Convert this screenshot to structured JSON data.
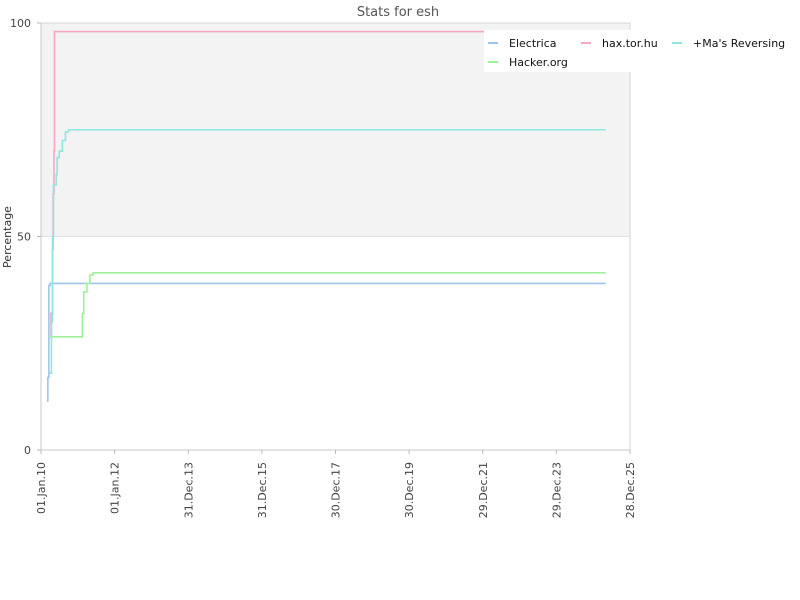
{
  "chart_data": {
    "type": "line",
    "title": "Stats for esh",
    "xlabel": "",
    "ylabel": "Percentage",
    "ylim": [
      0,
      100
    ],
    "xlim": [
      "2010-01-01",
      "2025-12-28"
    ],
    "y_ticks": [
      0,
      50,
      100
    ],
    "x_ticks": [
      {
        "date": "2010-01-01",
        "label": "01.Jan.10"
      },
      {
        "date": "2012-01-01",
        "label": "01.Jan.12"
      },
      {
        "date": "2013-12-31",
        "label": "31.Dec.13"
      },
      {
        "date": "2015-12-31",
        "label": "31.Dec.15"
      },
      {
        "date": "2017-12-30",
        "label": "30.Dec.17"
      },
      {
        "date": "2019-12-30",
        "label": "30.Dec.19"
      },
      {
        "date": "2021-12-29",
        "label": "29.Dec.21"
      },
      {
        "date": "2023-12-29",
        "label": "29.Dec.23"
      },
      {
        "date": "2025-12-28",
        "label": "28.Dec.25"
      }
    ],
    "background_bands": [
      {
        "from": 50,
        "to": 100,
        "color": "#f3f3f3"
      }
    ],
    "legend": {
      "placement": "top-right"
    },
    "series": [
      {
        "name": "Electrica",
        "color": "#9ec4ee",
        "points": [
          [
            "2010-03-01",
            11.5
          ],
          [
            "2010-03-10",
            17
          ],
          [
            "2010-03-20",
            38.5
          ],
          [
            "2010-04-01",
            39
          ],
          [
            "2025-05-01",
            39
          ]
        ]
      },
      {
        "name": "hax.tor.hu",
        "color": "#f5a7c5",
        "points": [
          [
            "2010-03-20",
            26.5
          ],
          [
            "2010-04-10",
            32
          ],
          [
            "2010-04-25",
            47
          ],
          [
            "2010-05-01",
            60
          ],
          [
            "2010-05-10",
            70
          ],
          [
            "2010-05-15",
            98
          ],
          [
            "2022-02-01",
            98
          ]
        ]
      },
      {
        "name": "+Ma's Reversing",
        "color": "#8fe6de",
        "points": [
          [
            "2010-03-20",
            18
          ],
          [
            "2010-04-10",
            18
          ],
          [
            "2010-04-15",
            30
          ],
          [
            "2010-04-25",
            50
          ],
          [
            "2010-05-05",
            62
          ],
          [
            "2010-06-01",
            64.5
          ],
          [
            "2010-06-10",
            68.5
          ],
          [
            "2010-07-01",
            70
          ],
          [
            "2010-08-01",
            72.5
          ],
          [
            "2010-09-01",
            74.5
          ],
          [
            "2010-10-01",
            75
          ],
          [
            "2025-05-01",
            75
          ]
        ]
      },
      {
        "name": "Hacker.org",
        "color": "#9ff09a",
        "points": [
          [
            "2010-03-20",
            26.5
          ],
          [
            "2011-02-01",
            26.5
          ],
          [
            "2011-02-15",
            32
          ],
          [
            "2011-03-01",
            37
          ],
          [
            "2011-04-01",
            39
          ],
          [
            "2011-05-01",
            41
          ],
          [
            "2011-06-01",
            41.5
          ],
          [
            "2025-05-01",
            41.5
          ]
        ]
      }
    ]
  }
}
